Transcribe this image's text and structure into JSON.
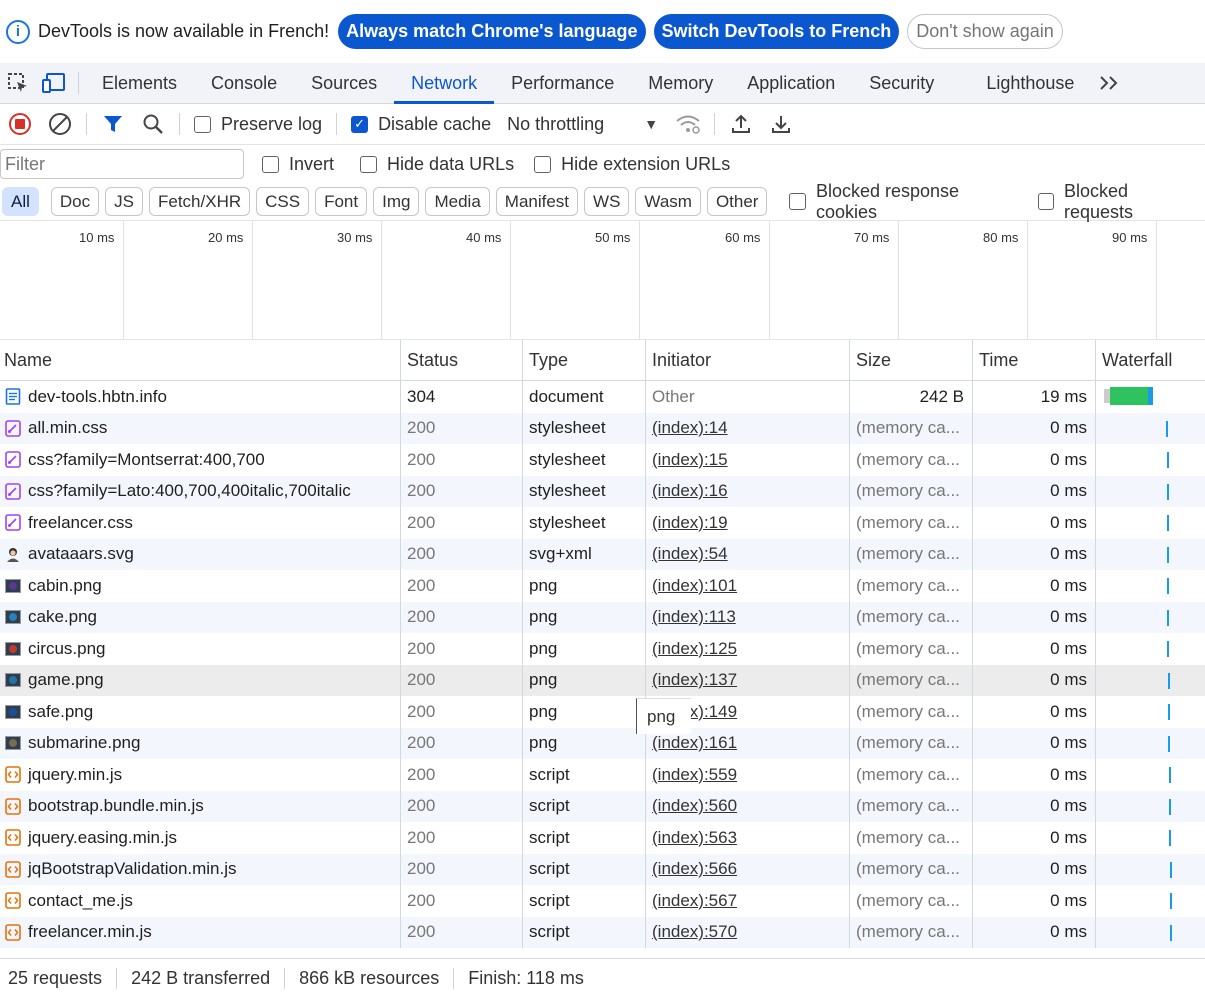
{
  "infobar": {
    "message": "DevTools is now available in French!",
    "match_button": "Always match Chrome's language",
    "switch_button": "Switch DevTools to French",
    "dismiss_button": "Don't show again"
  },
  "tabs": [
    "Elements",
    "Console",
    "Sources",
    "Network",
    "Performance",
    "Memory",
    "Application",
    "Security",
    "Lighthouse"
  ],
  "active_tab": "Network",
  "toolbar": {
    "preserve_log": "Preserve log",
    "preserve_log_checked": false,
    "disable_cache": "Disable cache",
    "disable_cache_checked": true,
    "throttling": "No throttling"
  },
  "filter": {
    "placeholder": "Filter",
    "invert": "Invert",
    "hide_data_urls": "Hide data URLs",
    "hide_extension_urls": "Hide extension URLs"
  },
  "type_chips": [
    "All",
    "Doc",
    "JS",
    "Fetch/XHR",
    "CSS",
    "Font",
    "Img",
    "Media",
    "Manifest",
    "WS",
    "Wasm",
    "Other"
  ],
  "active_chip": "All",
  "blocked_response_cookies": "Blocked response cookies",
  "blocked_requests": "Blocked requests",
  "overview_ticks": [
    "10 ms",
    "20 ms",
    "30 ms",
    "40 ms",
    "50 ms",
    "60 ms",
    "70 ms",
    "80 ms",
    "90 ms"
  ],
  "columns": {
    "name": "Name",
    "status": "Status",
    "type": "Type",
    "initiator": "Initiator",
    "size": "Size",
    "time": "Time",
    "waterfall": "Waterfall"
  },
  "requests": [
    {
      "name": "dev-tools.hbtn.info",
      "status": "304",
      "type": "document",
      "initiator": "Other",
      "size": "242 B",
      "time": "19 ms",
      "icon": "document-icon"
    },
    {
      "name": "all.min.css",
      "status": "200",
      "type": "stylesheet",
      "initiator": "(index):14",
      "size": "(memory ca...",
      "time": "0 ms",
      "icon": "stylesheet-icon"
    },
    {
      "name": "css?family=Montserrat:400,700",
      "status": "200",
      "type": "stylesheet",
      "initiator": "(index):15",
      "size": "(memory ca...",
      "time": "0 ms",
      "icon": "stylesheet-icon"
    },
    {
      "name": "css?family=Lato:400,700,400italic,700italic",
      "status": "200",
      "type": "stylesheet",
      "initiator": "(index):16",
      "size": "(memory ca...",
      "time": "0 ms",
      "icon": "stylesheet-icon"
    },
    {
      "name": "freelancer.css",
      "status": "200",
      "type": "stylesheet",
      "initiator": "(index):19",
      "size": "(memory ca...",
      "time": "0 ms",
      "icon": "stylesheet-icon"
    },
    {
      "name": "avataaars.svg",
      "status": "200",
      "type": "svg+xml",
      "initiator": "(index):54",
      "size": "(memory ca...",
      "time": "0 ms",
      "icon": "avatar-image-icon"
    },
    {
      "name": "cabin.png",
      "status": "200",
      "type": "png",
      "initiator": "(index):101",
      "size": "(memory ca...",
      "time": "0 ms",
      "icon": "image-thumbnail-icon"
    },
    {
      "name": "cake.png",
      "status": "200",
      "type": "png",
      "initiator": "(index):113",
      "size": "(memory ca...",
      "time": "0 ms",
      "icon": "image-thumbnail-icon"
    },
    {
      "name": "circus.png",
      "status": "200",
      "type": "png",
      "initiator": "(index):125",
      "size": "(memory ca...",
      "time": "0 ms",
      "icon": "image-thumbnail-icon"
    },
    {
      "name": "game.png",
      "status": "200",
      "type": "png",
      "initiator": "(index):137",
      "size": "(memory ca...",
      "time": "0 ms",
      "icon": "image-thumbnail-icon"
    },
    {
      "name": "safe.png",
      "status": "200",
      "type": "png",
      "initiator": "(index):149",
      "size": "(memory ca...",
      "time": "0 ms",
      "icon": "image-thumbnail-icon"
    },
    {
      "name": "submarine.png",
      "status": "200",
      "type": "png",
      "initiator": "(index):161",
      "size": "(memory ca...",
      "time": "0 ms",
      "icon": "image-thumbnail-icon"
    },
    {
      "name": "jquery.min.js",
      "status": "200",
      "type": "script",
      "initiator": "(index):559",
      "size": "(memory ca...",
      "time": "0 ms",
      "icon": "script-icon"
    },
    {
      "name": "bootstrap.bundle.min.js",
      "status": "200",
      "type": "script",
      "initiator": "(index):560",
      "size": "(memory ca...",
      "time": "0 ms",
      "icon": "script-icon"
    },
    {
      "name": "jquery.easing.min.js",
      "status": "200",
      "type": "script",
      "initiator": "(index):563",
      "size": "(memory ca...",
      "time": "0 ms",
      "icon": "script-icon"
    },
    {
      "name": "jqBootstrapValidation.min.js",
      "status": "200",
      "type": "script",
      "initiator": "(index):566",
      "size": "(memory ca...",
      "time": "0 ms",
      "icon": "script-icon"
    },
    {
      "name": "contact_me.js",
      "status": "200",
      "type": "script",
      "initiator": "(index):567",
      "size": "(memory ca...",
      "time": "0 ms",
      "icon": "script-icon"
    },
    {
      "name": "freelancer.min.js",
      "status": "200",
      "type": "script",
      "initiator": "(index):570",
      "size": "(memory ca...",
      "time": "0 ms",
      "icon": "script-icon"
    }
  ],
  "tooltip": "png",
  "statusbar": {
    "requests": "25 requests",
    "transferred": "242 B transferred",
    "resources": "866 kB resources",
    "finish": "Finish: 118 ms"
  },
  "colors": {
    "accent": "#0b57d0",
    "waterfall_bar": "#1a9be8",
    "waterfall_receive": "#2ec35f"
  }
}
